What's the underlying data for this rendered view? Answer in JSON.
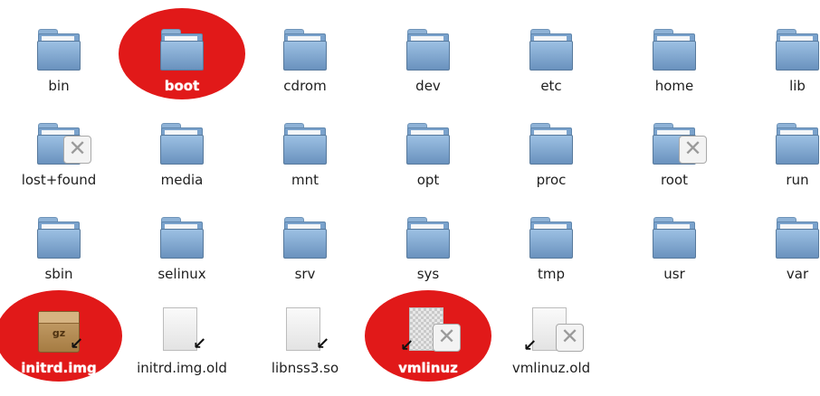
{
  "items": [
    {
      "label": "bin",
      "icon": "folder-icon"
    },
    {
      "label": "boot",
      "icon": "folder-icon",
      "selected": true
    },
    {
      "label": "cdrom",
      "icon": "folder-icon"
    },
    {
      "label": "dev",
      "icon": "folder-icon"
    },
    {
      "label": "etc",
      "icon": "folder-icon"
    },
    {
      "label": "home",
      "icon": "folder-icon"
    },
    {
      "label": "lib",
      "icon": "folder-icon"
    },
    {
      "label": "lost+found",
      "icon": "folder-icon",
      "no_access": true
    },
    {
      "label": "media",
      "icon": "folder-icon"
    },
    {
      "label": "mnt",
      "icon": "folder-icon"
    },
    {
      "label": "opt",
      "icon": "folder-icon"
    },
    {
      "label": "proc",
      "icon": "folder-icon"
    },
    {
      "label": "root",
      "icon": "folder-icon",
      "no_access": true
    },
    {
      "label": "run",
      "icon": "folder-icon"
    },
    {
      "label": "sbin",
      "icon": "folder-icon"
    },
    {
      "label": "selinux",
      "icon": "folder-icon"
    },
    {
      "label": "srv",
      "icon": "folder-icon"
    },
    {
      "label": "sys",
      "icon": "folder-icon"
    },
    {
      "label": "tmp",
      "icon": "folder-icon"
    },
    {
      "label": "usr",
      "icon": "folder-icon"
    },
    {
      "label": "var",
      "icon": "folder-icon"
    },
    {
      "label": "initrd.img",
      "icon": "archive-icon",
      "badge": "gz",
      "symlink": true,
      "selected": true
    },
    {
      "label": "initrd.img.old",
      "icon": "document-icon",
      "symlink": true
    },
    {
      "label": "libnss3.so",
      "icon": "document-icon",
      "symlink": true
    },
    {
      "label": "vmlinuz",
      "icon": "binary-document-icon",
      "symlink": true,
      "no_access": true,
      "selected": true
    },
    {
      "label": "vmlinuz.old",
      "icon": "document-icon",
      "symlink": true,
      "no_access": true
    }
  ],
  "colors": {
    "selection": "#e11919",
    "folder": "#7aa2cc",
    "label": "#1e1e1e"
  }
}
